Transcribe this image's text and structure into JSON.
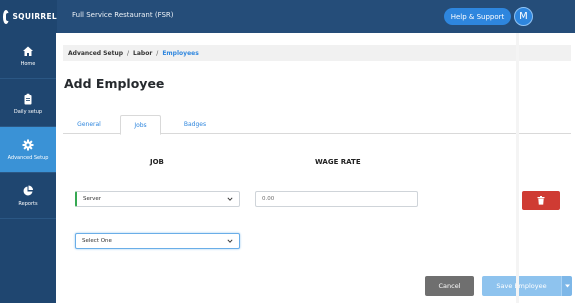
{
  "brand": {
    "name": "SQUIRREL"
  },
  "header": {
    "title": "Full Service Restaurant (FSR)",
    "help_label": "Help & Support",
    "avatar_initial": "M"
  },
  "sidebar": {
    "items": [
      {
        "label": "Home",
        "icon": "home-icon",
        "active": false
      },
      {
        "label": "Daily setup",
        "icon": "clipboard-icon",
        "active": false
      },
      {
        "label": "Advanced Setup",
        "icon": "gear-icon",
        "active": true
      },
      {
        "label": "Reports",
        "icon": "pie-chart-icon",
        "active": false
      }
    ]
  },
  "breadcrumb": {
    "items": [
      "Advanced Setup",
      "Labor",
      "Employees"
    ]
  },
  "page": {
    "title": "Add Employee"
  },
  "tabs": [
    {
      "label": "General",
      "active": false
    },
    {
      "label": "Jobs",
      "active": true
    },
    {
      "label": "Badges",
      "active": false
    }
  ],
  "columns": {
    "job": "JOB",
    "wage_rate": "WAGE RATE"
  },
  "rows": [
    {
      "job": "Server",
      "wage_placeholder": "0.00"
    }
  ],
  "new_job_select": {
    "value": "Select One"
  },
  "actions": {
    "cancel_label": "Cancel",
    "save_label": "Save Employee"
  },
  "colors": {
    "topbar": "#254d79",
    "sidebar": "#1f4670",
    "active_nav": "#3a92d6",
    "accent": "#2e86de",
    "delete": "#cf3b33"
  }
}
